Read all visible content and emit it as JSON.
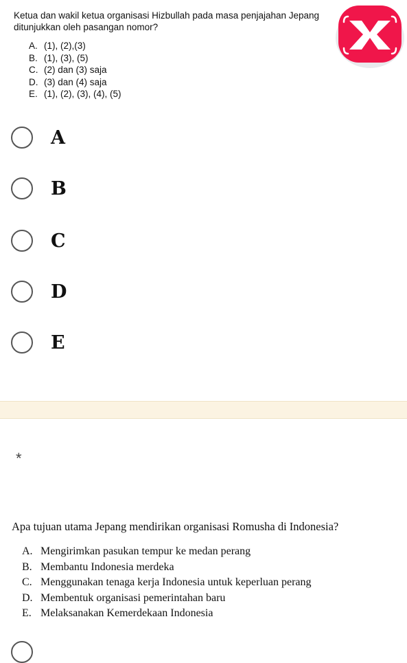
{
  "question1": {
    "stem": "Ketua dan wakil ketua organisasi Hizbullah pada masa penjajahan Jepang ditunjukkan oleh pasangan nomor?",
    "options": [
      {
        "letter": "A.",
        "text": "(1), (2),(3)"
      },
      {
        "letter": "B.",
        "text": "(1), (3), (5)"
      },
      {
        "letter": "C.",
        "text": "(2) dan (3) saja"
      },
      {
        "letter": "D.",
        "text": "(3) dan (4) saja"
      },
      {
        "letter": "E.",
        "text": "(1), (2), (3), (4), (5)"
      }
    ],
    "choices": [
      "A",
      "B",
      "C",
      "D",
      "E"
    ]
  },
  "logo": {
    "icon": "app-logo-icon",
    "color": "#f0164a"
  },
  "question2": {
    "required_mark": "*",
    "stem": "Apa tujuan utama Jepang mendirikan organisasi Romusha di Indonesia?",
    "options": [
      {
        "letter": "A.",
        "text": "Mengirimkan pasukan tempur ke medan perang"
      },
      {
        "letter": "B.",
        "text": "Membantu Indonesia merdeka"
      },
      {
        "letter": "C.",
        "text": "Menggunakan tenaga kerja Indonesia untuk keperluan perang"
      },
      {
        "letter": "D.",
        "text": "Membentuk organisasi pemerintahan baru"
      },
      {
        "letter": "E.",
        "text": "Melaksanakan Kemerdekaan Indonesia"
      }
    ]
  }
}
